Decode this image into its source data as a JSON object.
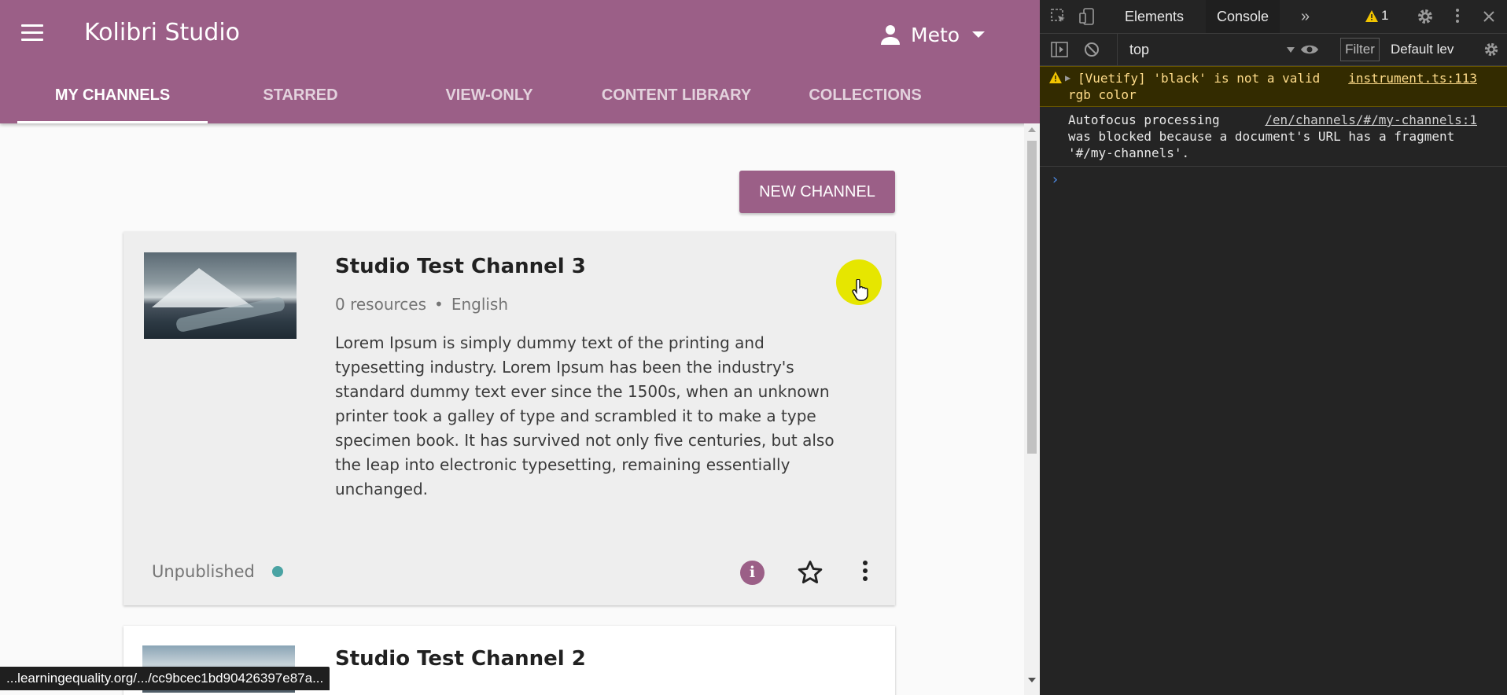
{
  "app": {
    "title": "Kolibri Studio",
    "user_name": "Meto",
    "tabs": [
      "MY CHANNELS",
      "STARRED",
      "VIEW-ONLY",
      "CONTENT LIBRARY",
      "COLLECTIONS"
    ],
    "active_tab": "MY CHANNELS",
    "new_channel_label": "NEW CHANNEL",
    "colors": {
      "brand": "#9b5f87",
      "published_dot": "#4aa3a3"
    }
  },
  "channels": [
    {
      "title": "Studio Test Channel 3",
      "resources": "0 resources",
      "separator": "•",
      "language": "English",
      "description": "Lorem Ipsum is simply dummy text of the printing and typesetting industry. Lorem Ipsum has been the industry's standard dummy text ever since the 1500s, when an unknown printer took a galley of type and scrambled it to make a type specimen book. It has survived not only five centuries, but also the leap into electronic typesetting, remaining essentially unchanged.",
      "status": "Unpublished",
      "info_icon": "info-icon",
      "star_icon": "star-outline-icon",
      "more_icon": "more-vertical-icon"
    },
    {
      "title": "Studio Test Channel 2"
    }
  ],
  "status_bar_url": "...learningequality.org/.../cc9bcec1bd90426397e87a...",
  "devtools": {
    "tabs": [
      "Elements",
      "Console"
    ],
    "active_tab": "Console",
    "more_tabs": "»",
    "warning_count": "1",
    "context": "top",
    "filter_placeholder": "Filter",
    "levels": "Default lev",
    "messages": [
      {
        "type": "warning",
        "text_line1": "[Vuetify] 'black' is not a valid",
        "text_line2": "rgb color",
        "source": "instrument.ts:113"
      },
      {
        "type": "info",
        "text_line1": "Autofocus processing",
        "text_line2": "was blocked because a document's URL has a fragment",
        "text_line3": "'#/my-channels'.",
        "source": "/en/channels/#/my-channels:1"
      }
    ],
    "prompt": "›"
  }
}
